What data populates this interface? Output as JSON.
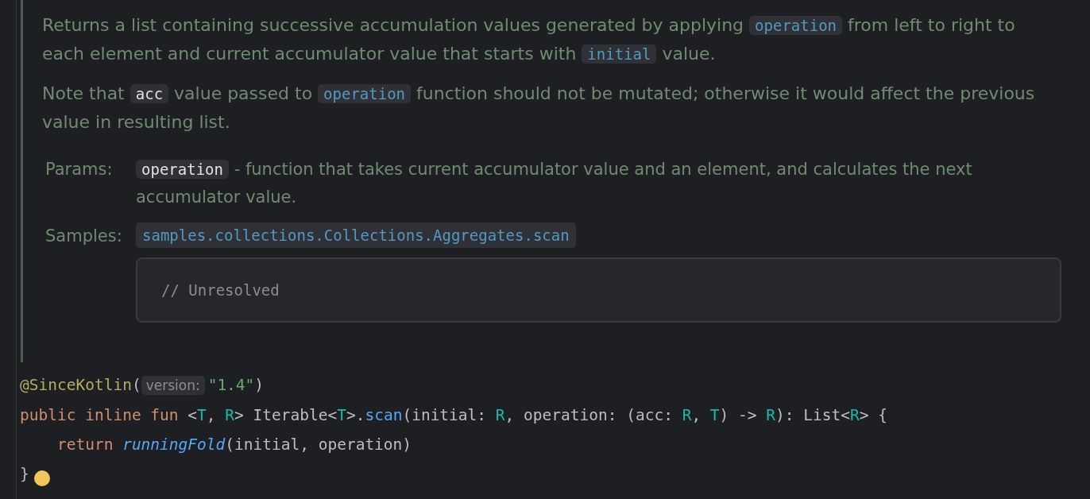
{
  "doc": {
    "paragraphs": [
      [
        {
          "kind": "text",
          "text": "Returns a list containing successive accumulation values generated by applying "
        },
        {
          "kind": "link",
          "text": "operation"
        },
        {
          "kind": "text",
          "text": " from left to right to each element and current accumulator value that starts with "
        },
        {
          "kind": "link",
          "text": "initial"
        },
        {
          "kind": "text",
          "text": " value."
        }
      ],
      [
        {
          "kind": "text",
          "text": "Note that "
        },
        {
          "kind": "code",
          "text": "acc"
        },
        {
          "kind": "text",
          "text": " value passed to "
        },
        {
          "kind": "link",
          "text": "operation"
        },
        {
          "kind": "text",
          "text": " function should not be mutated; otherwise it would affect the previous value in resulting list."
        }
      ]
    ],
    "params": {
      "label": "Params:",
      "items": [
        {
          "name": "operation",
          "description": " - function that takes current accumulator value and an element, and calculates the next accumulator value."
        }
      ]
    },
    "samples": {
      "label": "Samples:",
      "link": "samples.collections.Collections.Aggregates.scan",
      "code": "// Unresolved"
    }
  },
  "code": {
    "lines": [
      [
        {
          "kind": "annotation",
          "text": "@SinceKotlin"
        },
        {
          "kind": "plain",
          "text": "("
        },
        {
          "kind": "hint",
          "text": "version:"
        },
        {
          "kind": "string",
          "text": "\"1.4\""
        },
        {
          "kind": "plain",
          "text": ")"
        }
      ],
      [
        {
          "kind": "keyword",
          "text": "public inline fun "
        },
        {
          "kind": "plain",
          "text": "<"
        },
        {
          "kind": "typeparam",
          "text": "T"
        },
        {
          "kind": "plain",
          "text": ", "
        },
        {
          "kind": "typeparam",
          "text": "R"
        },
        {
          "kind": "plain",
          "text": "> Iterable<"
        },
        {
          "kind": "typeparam",
          "text": "T"
        },
        {
          "kind": "plain",
          "text": ">."
        },
        {
          "kind": "function",
          "text": "scan"
        },
        {
          "kind": "plain",
          "text": "(initial: "
        },
        {
          "kind": "typeparam",
          "text": "R"
        },
        {
          "kind": "plain",
          "text": ", operation: (acc: "
        },
        {
          "kind": "typeparam",
          "text": "R"
        },
        {
          "kind": "plain",
          "text": ", "
        },
        {
          "kind": "typeparam",
          "text": "T"
        },
        {
          "kind": "plain",
          "text": ") -> "
        },
        {
          "kind": "typeparam",
          "text": "R"
        },
        {
          "kind": "plain",
          "text": "): List<"
        },
        {
          "kind": "typeparam",
          "text": "R"
        },
        {
          "kind": "plain",
          "text": "> {"
        }
      ],
      [
        {
          "kind": "keyword",
          "text": "    return "
        },
        {
          "kind": "call",
          "text": "runningFold"
        },
        {
          "kind": "plain",
          "text": "(initial, operation)"
        }
      ],
      [
        {
          "kind": "plain",
          "text": "}"
        }
      ]
    ]
  }
}
